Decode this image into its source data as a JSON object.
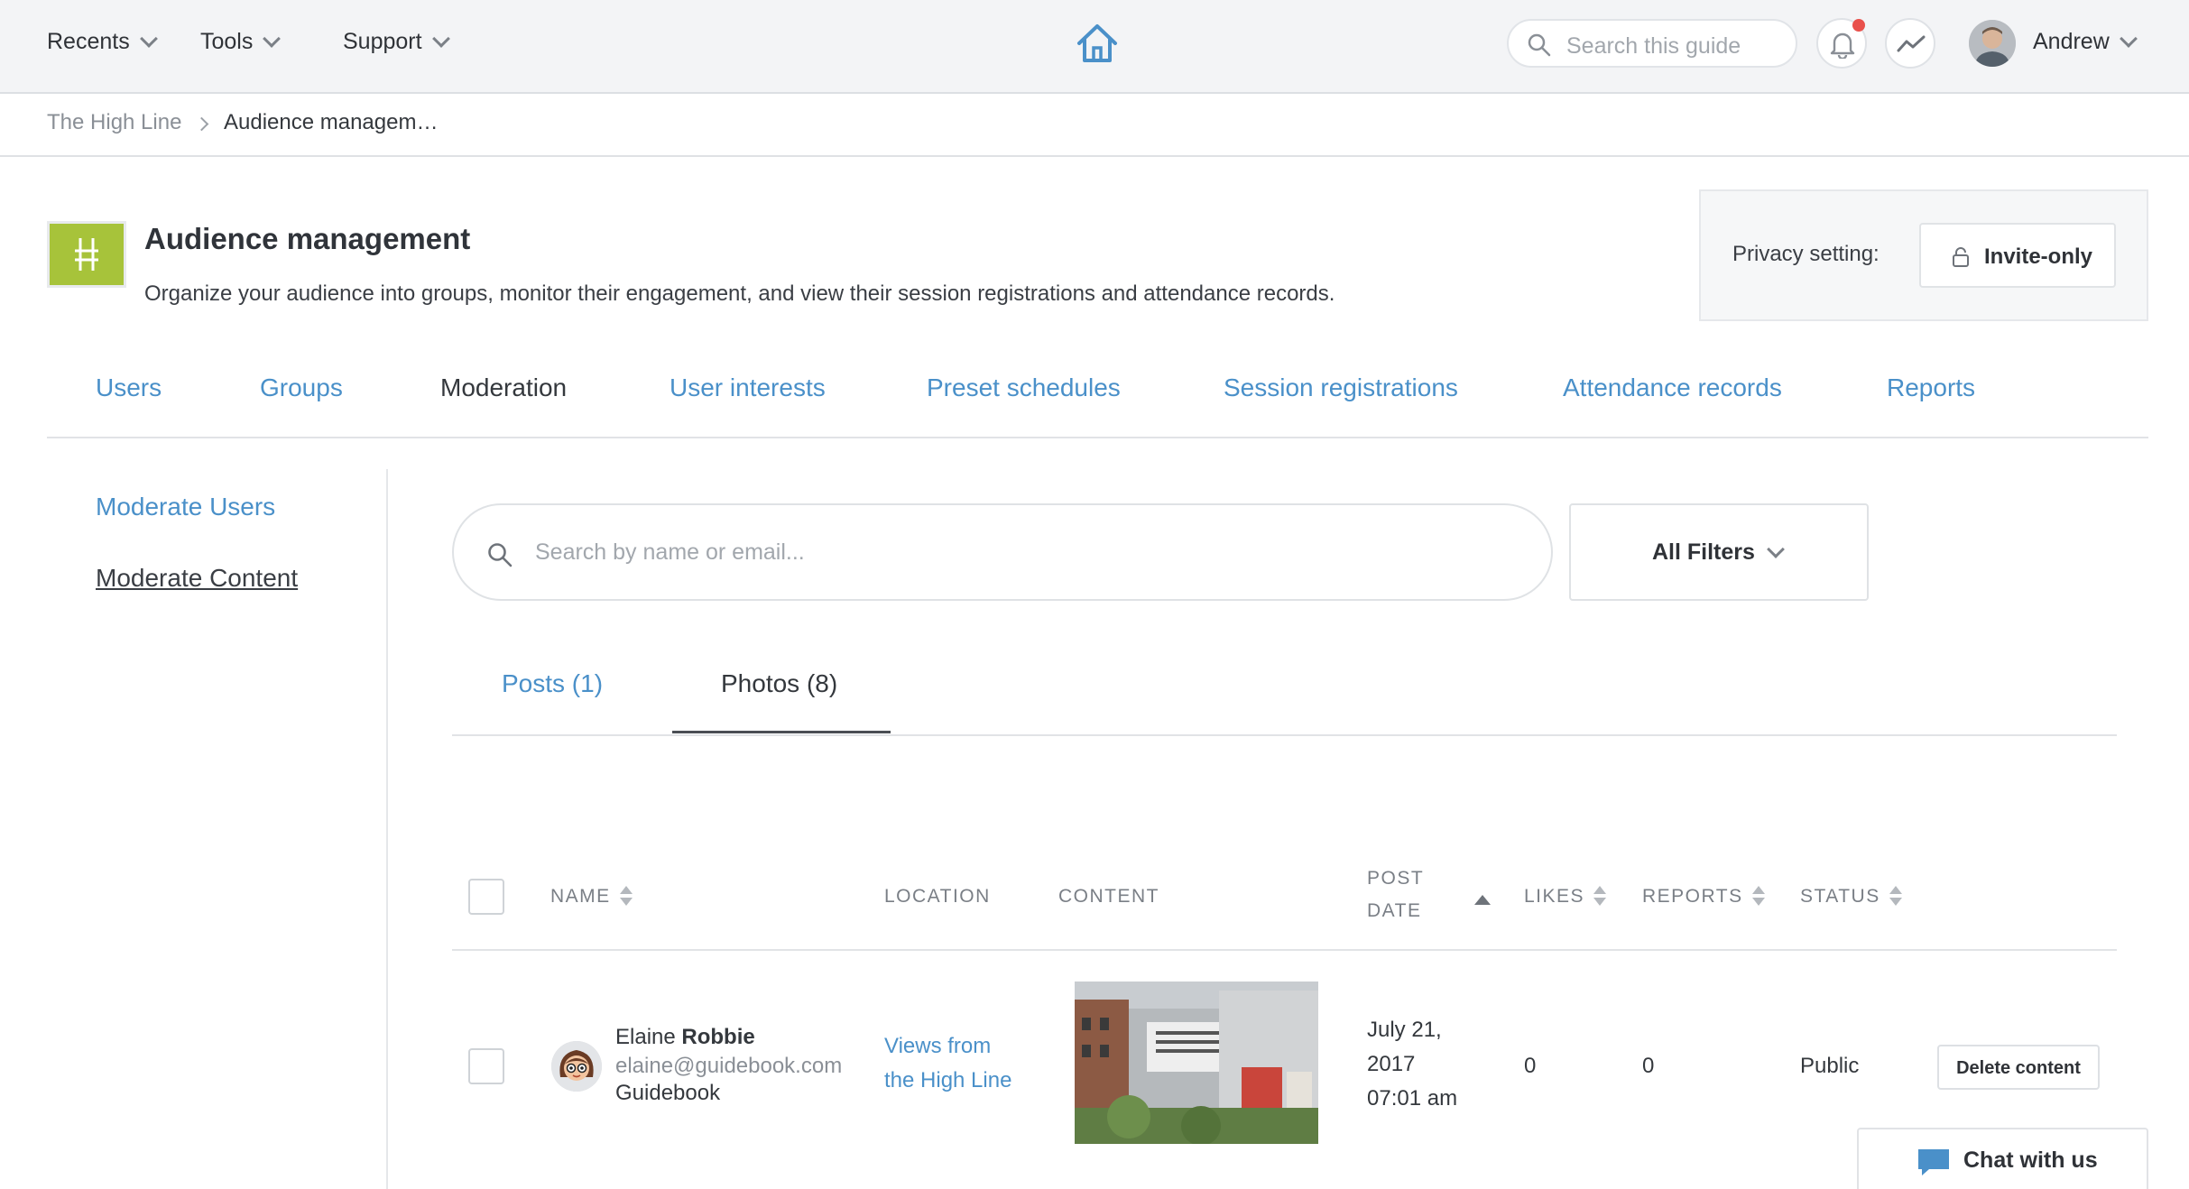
{
  "topnav": {
    "menus": [
      {
        "label": "Recents"
      },
      {
        "label": "Tools"
      },
      {
        "label": "Support"
      }
    ],
    "search_placeholder": "Search this guide",
    "user_name": "Andrew",
    "home_icon": "home-icon",
    "notification_icon": "bell-icon",
    "activity_icon": "activity-icon"
  },
  "breadcrumb": {
    "items": [
      "The High Line",
      "Audience managem…"
    ]
  },
  "header": {
    "title": "Audience management",
    "description": "Organize your audience into groups, monitor their engagement, and view their session registrations and attendance records.",
    "privacy_label": "Privacy setting:",
    "privacy_value": "Invite-only"
  },
  "tabs": [
    {
      "label": "Users",
      "active": false
    },
    {
      "label": "Groups",
      "active": false
    },
    {
      "label": "Moderation",
      "active": true
    },
    {
      "label": "User interests",
      "active": false
    },
    {
      "label": "Preset schedules",
      "active": false
    },
    {
      "label": "Session registrations",
      "active": false
    },
    {
      "label": "Attendance records",
      "active": false
    },
    {
      "label": "Reports",
      "active": false
    }
  ],
  "sidenav": {
    "items": [
      {
        "label": "Moderate Users",
        "active": false
      },
      {
        "label": "Moderate Content",
        "active": true
      }
    ]
  },
  "content": {
    "search_placeholder": "Search by name or email...",
    "filters_label": "All Filters",
    "subtabs": [
      {
        "label": "Posts (1)",
        "active": false
      },
      {
        "label": "Photos (8)",
        "active": true
      }
    ],
    "table": {
      "headers": {
        "name": "NAME",
        "location": "LOCATION",
        "content": "CONTENT",
        "post_date_1": "POST",
        "post_date_2": "DATE",
        "likes": "LIKES",
        "reports": "REPORTS",
        "status": "STATUS"
      },
      "rows": [
        {
          "first_name": "Elaine",
          "last_name": "Robbie",
          "email": "elaine@guidebook.com",
          "org": "Guidebook",
          "location_1": "Views from",
          "location_2": "the High Line",
          "date_1": "July 21,",
          "date_2": "2017",
          "date_3": "07:01 am",
          "likes": "0",
          "reports": "0",
          "status": "Public",
          "action": "Delete content"
        }
      ]
    }
  },
  "chat": {
    "label": "Chat with us"
  },
  "colors": {
    "link": "#4a90c9",
    "brand_logo": "#a7c33a",
    "notification": "#e9504b"
  }
}
